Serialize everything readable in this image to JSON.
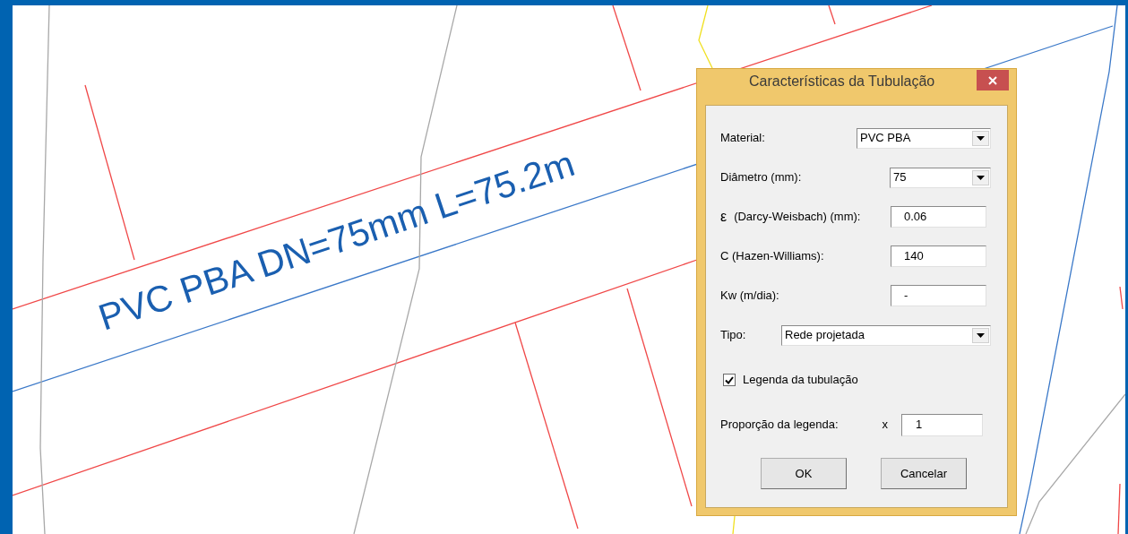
{
  "drawing": {
    "pipe_label": "PVC PBA DN=75mm L=75.2m"
  },
  "dialog": {
    "title": "Características da Tubulação",
    "fields": [
      {
        "kind": "combo",
        "label": "Material:",
        "value": "PVC PBA"
      },
      {
        "kind": "combo",
        "label": "Diâmetro (mm):",
        "value": "75"
      },
      {
        "kind": "text",
        "symbol": "ε",
        "label": "(Darcy-Weisbach) (mm):",
        "value": "0.06"
      },
      {
        "kind": "text",
        "label": "C (Hazen-Williams):",
        "value": "140"
      },
      {
        "kind": "text",
        "label": "Kw (m/dia):",
        "value": "-"
      },
      {
        "kind": "combo",
        "label": "Tipo:",
        "value": "Rede projetada"
      },
      {
        "kind": "check",
        "label": "Legenda da tubulação",
        "checked": true
      },
      {
        "kind": "scale",
        "label": "Proporção da legenda:",
        "prefix": "x",
        "value": "1"
      }
    ],
    "buttons": [
      "OK",
      "Cancelar"
    ]
  }
}
